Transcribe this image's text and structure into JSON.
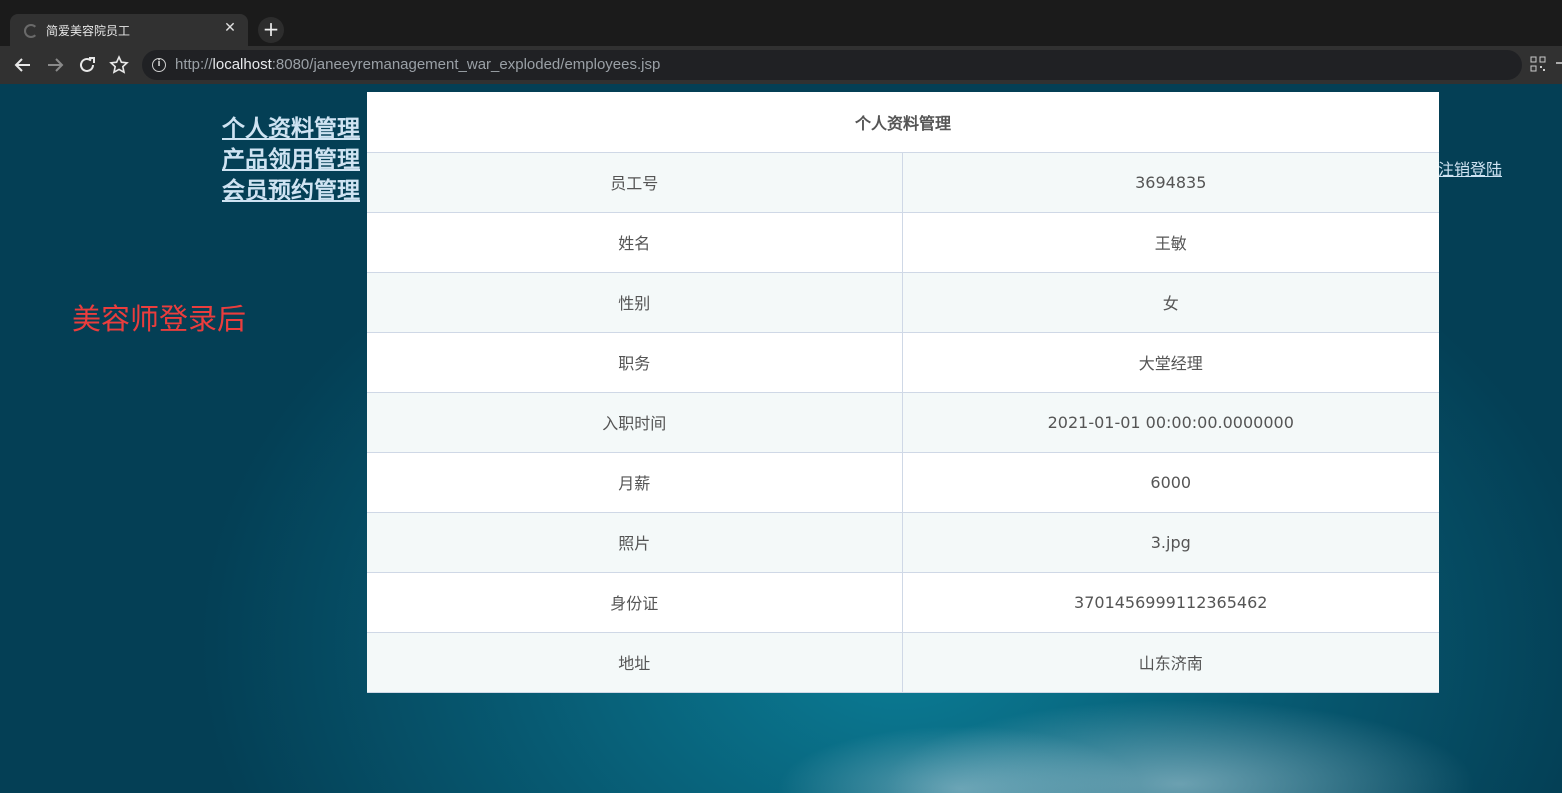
{
  "browser": {
    "tab_title": "简爱美容院员工",
    "tab_close": "✕",
    "new_tab": "+",
    "url_scheme": "http://",
    "url_host": "localhost",
    "url_rest": ":8080/janeeyremanagement_war_exploded/employees.jsp"
  },
  "side_nav": {
    "items": [
      "个人资料管理",
      "产品领用管理",
      "会员预约管理"
    ]
  },
  "logout_label": "注销登陆",
  "annotation": "美容师登录后",
  "profile": {
    "title": "个人资料管理",
    "rows": [
      {
        "label": "员工号",
        "value": "3694835"
      },
      {
        "label": "姓名",
        "value": "王敏"
      },
      {
        "label": "性别",
        "value": "女"
      },
      {
        "label": "职务",
        "value": "大堂经理"
      },
      {
        "label": "入职时间",
        "value": "2021-01-01 00:00:00.0000000"
      },
      {
        "label": "月薪",
        "value": "6000"
      },
      {
        "label": "照片",
        "value": "3.jpg"
      },
      {
        "label": "身份证",
        "value": "370145699911236546​2"
      },
      {
        "label": "地址",
        "value": "山东济南"
      }
    ]
  },
  "colors": {
    "annotation": "#ea3d3d",
    "link": "#cfe3f2",
    "table_border": "#cfd8e6",
    "row_alt": "#f4f9f9"
  }
}
